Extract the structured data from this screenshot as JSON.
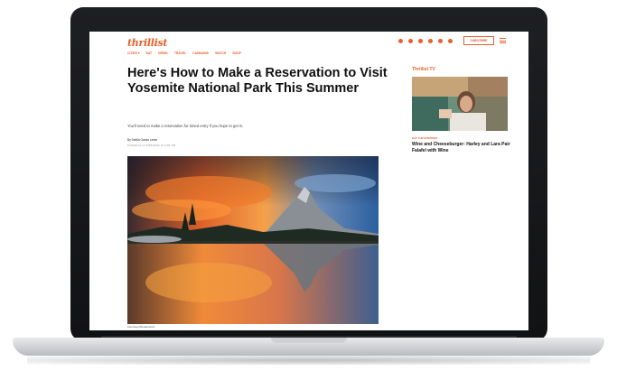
{
  "site": {
    "logo": "thrillist"
  },
  "nav": [
    "CITIES ▾",
    "EAT",
    "DRINK",
    "TRAVEL",
    "CANNABIS",
    "WATCH",
    "SHOP"
  ],
  "header": {
    "subscribe_label": "SUBSCRIBE"
  },
  "article": {
    "headline": "Here's How to Make a Reservation to Visit Yosemite National Park This Summer",
    "dek": "You'll need to make a reservation for timed entry if you hope to get in.",
    "byline": "By Dahlia Garcia Lewin",
    "dateline": "Published on 5/25/2022 at 4:00 PM",
    "image_credit": "Zeroduey/Shutterstock"
  },
  "sidebar": {
    "section_label": "Thrillist TV",
    "video_kicker": "EAT THE INTERNET",
    "video_title": "Wine and Cheeseburger: Harley and Lara Pair Falafel with Wine"
  },
  "colors": {
    "brand": "#e8602c"
  }
}
